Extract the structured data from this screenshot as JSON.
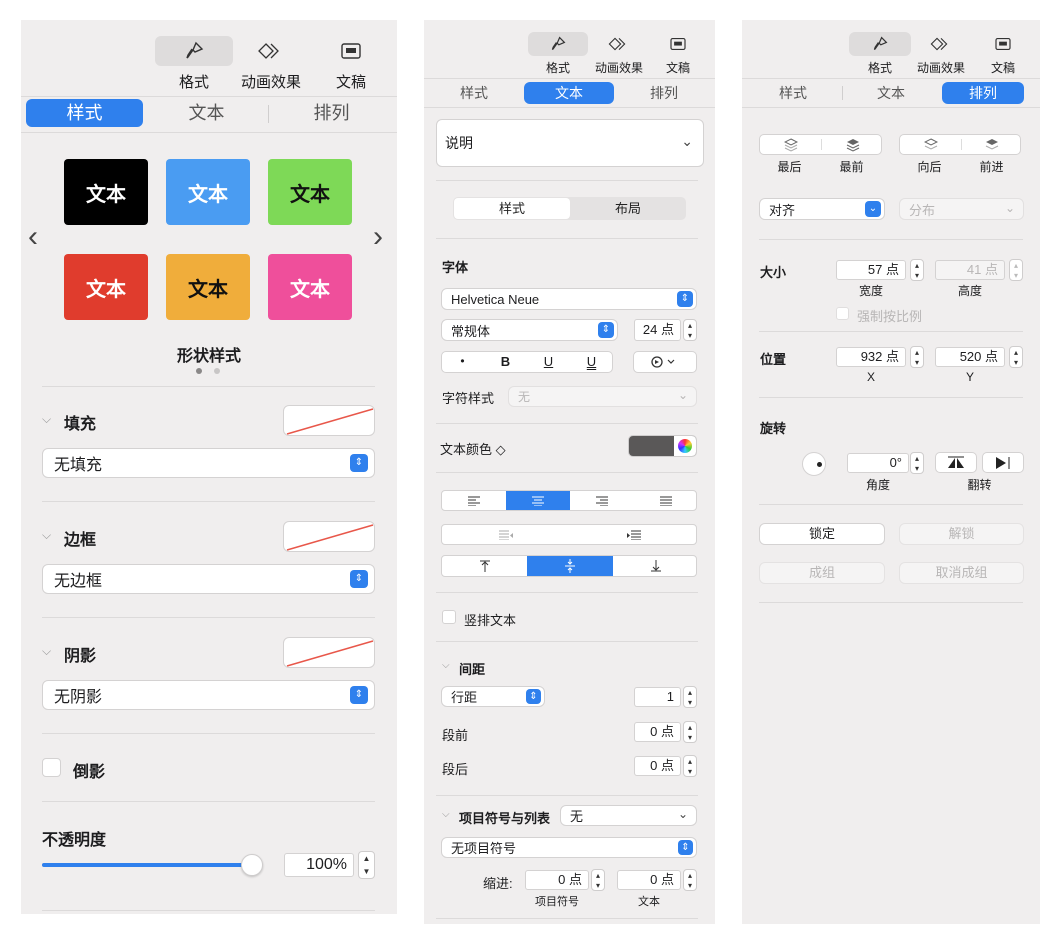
{
  "toolbar": {
    "format": "格式",
    "animate": "动画效果",
    "document": "文稿"
  },
  "tabs": {
    "style": "样式",
    "text": "文本",
    "arrange": "排列"
  },
  "p1": {
    "swatches": [
      {
        "label": "文本",
        "color": "#000000"
      },
      {
        "label": "文本",
        "color": "#4a9cf2"
      },
      {
        "label": "文本",
        "color": "#7ed957"
      },
      {
        "label": "文本",
        "color": "#e03c2d"
      },
      {
        "label": "文本",
        "color": "#f0ad3b"
      },
      {
        "label": "文本",
        "color": "#ef4f9b"
      }
    ],
    "nav_prev": "‹",
    "nav_next": "›",
    "shape_styles": "形状样式",
    "fill": {
      "title": "填充",
      "value": "无填充"
    },
    "border": {
      "title": "边框",
      "value": "无边框"
    },
    "shadow": {
      "title": "阴影",
      "value": "无阴影"
    },
    "reflection": "倒影",
    "opacity": {
      "title": "不透明度",
      "value": "100%",
      "level": 1.0
    }
  },
  "p2": {
    "style_popup": "说明",
    "subtabs": {
      "style": "样式",
      "layout": "布局"
    },
    "font_title": "字体",
    "font_name": "Helvetica Neue",
    "font_style": "常规体",
    "font_size": "24 点",
    "fmt": {
      "bullet": "•",
      "bold": "B",
      "underline": "U",
      "underline2": "U"
    },
    "char_style_label": "字符样式",
    "char_style_value": "无",
    "text_color_label": "文本颜色 ◇",
    "vertical_text": "竖排文本",
    "spacing": {
      "title": "间距",
      "line_label": "行距",
      "line_value": "1",
      "before_label": "段前",
      "before_value": "0 点",
      "after_label": "段后",
      "after_value": "0 点"
    },
    "bullets": {
      "title": "项目符号与列表",
      "list_value": "无",
      "style_value": "无项目符号",
      "indent_label": "缩进:",
      "bullet_value": "0 点",
      "text_value": "0 点",
      "bullet_caption": "项目符号",
      "text_caption": "文本"
    }
  },
  "p3": {
    "order": {
      "back": "最后",
      "front": "最前",
      "backward": "向后",
      "forward": "前进"
    },
    "align": "对齐",
    "distribute": "分布",
    "size": {
      "title": "大小",
      "width": "57 点",
      "height": "41 点",
      "width_caption": "宽度",
      "height_caption": "高度",
      "constrain": "强制按比例"
    },
    "position": {
      "title": "位置",
      "x": "932 点",
      "y": "520 点",
      "x_caption": "X",
      "y_caption": "Y"
    },
    "rotate": {
      "title": "旋转",
      "angle": "0°",
      "angle_caption": "角度",
      "flip_caption": "翻转"
    },
    "lock": "锁定",
    "unlock": "解锁",
    "group": "成组",
    "ungroup": "取消成组"
  }
}
